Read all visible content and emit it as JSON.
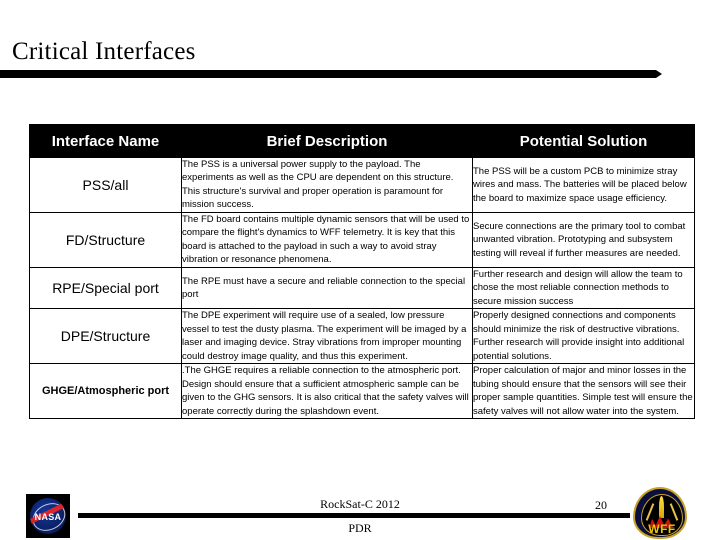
{
  "slide": {
    "title": "Critical Interfaces"
  },
  "table": {
    "headers": [
      "Interface Name",
      "Brief Description",
      "Potential Solution"
    ],
    "rows": [
      {
        "name": "PSS/all",
        "description": "The PSS is a universal power supply to the payload. The experiments as well as the CPU are dependent on this structure. This structure's survival and proper operation is paramount for mission success.",
        "solution": "The PSS will be a custom PCB to minimize stray wires and mass. The batteries will be placed below the board to maximize space usage efficiency."
      },
      {
        "name": "FD/Structure",
        "description": "The FD board contains multiple dynamic sensors that will be used to compare the flight's dynamics to WFF telemetry. It is key that this board is attached to the payload in such a way to avoid stray vibration or resonance phenomena.",
        "solution": "Secure connections are the primary tool to combat unwanted vibration. Prototyping and subsystem testing will reveal if further measures are needed."
      },
      {
        "name": "RPE/Special port",
        "description": "The RPE  must have a secure and reliable connection to the special port",
        "solution": "Further research and design will allow the team to chose the most reliable connection methods to secure mission success"
      },
      {
        "name": "DPE/Structure",
        "description": "The DPE experiment will require use of a sealed, low pressure vessel to test the dusty plasma. The experiment will be imaged by a laser and imaging device. Stray vibrations from improper mounting could destroy image quality, and thus this experiment.",
        "solution": "Properly designed connections and components should minimize the risk of destructive vibrations. Further research will provide insight into additional potential solutions."
      },
      {
        "name": "GHGE/Atmospheric port",
        "description": ".The GHGE requires a reliable connection to the atmospheric port. Design should ensure that a sufficient atmospheric sample can be given to the  GHG sensors. It is also critical that the safety valves will operate correctly during the splashdown event.",
        "solution": "Proper calculation of major and minor losses in the tubing should ensure that the sensors will see their proper sample  quantities. Simple test will ensure the safety valves will not allow water into the system."
      }
    ]
  },
  "footer": {
    "project": "RockSat-C 2012",
    "review": "PDR",
    "page_number": "20",
    "nasa_logo_text": "NASA",
    "wff_logo_text": "WFF"
  }
}
